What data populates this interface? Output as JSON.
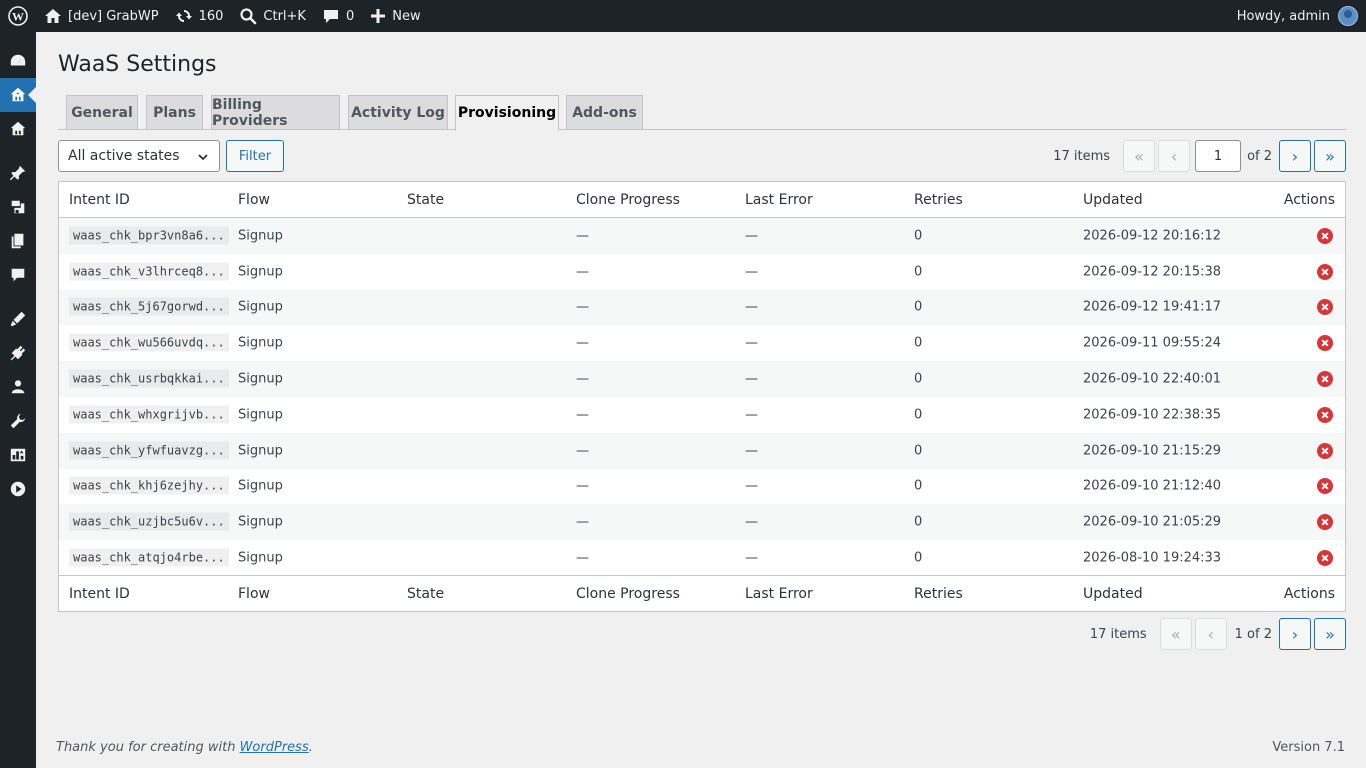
{
  "adminbar": {
    "site_name": "[dev] GrabWP",
    "updates_count": "160",
    "search_shortcut": "Ctrl+K",
    "comments_count": "0",
    "new_label": "New",
    "howdy": "Howdy, admin"
  },
  "page": {
    "title": "WaaS Settings"
  },
  "tabs": [
    {
      "label": "General",
      "active": false
    },
    {
      "label": "Plans",
      "active": false
    },
    {
      "label": "Billing Providers",
      "active": false
    },
    {
      "label": "Activity Log",
      "active": false
    },
    {
      "label": "Provisioning",
      "active": true
    },
    {
      "label": "Add-ons",
      "active": false
    }
  ],
  "filter": {
    "state_select": "All active states",
    "button_label": "Filter"
  },
  "pagination_top": {
    "items": "17 items",
    "first": "«",
    "prev": "‹",
    "current_page": "1",
    "of_label": "of 2",
    "next": "›",
    "last": "»"
  },
  "pagination_bottom": {
    "items": "17 items",
    "first": "«",
    "prev": "‹",
    "page_label": "1 of 2",
    "next": "›",
    "last": "»"
  },
  "table": {
    "columns": [
      "Intent ID",
      "Flow",
      "State",
      "Clone Progress",
      "Last Error",
      "Retries",
      "Updated",
      "Actions"
    ],
    "rows": [
      {
        "intent_id": "waas_chk_bpr3vn8a6...",
        "flow": "Signup",
        "state": "",
        "clone_progress": "—",
        "last_error": "—",
        "retries": "0",
        "updated": "2026-09-12 20:16:12"
      },
      {
        "intent_id": "waas_chk_v3lhrceq8...",
        "flow": "Signup",
        "state": "",
        "clone_progress": "—",
        "last_error": "—",
        "retries": "0",
        "updated": "2026-09-12 20:15:38"
      },
      {
        "intent_id": "waas_chk_5j67gorwd...",
        "flow": "Signup",
        "state": "",
        "clone_progress": "—",
        "last_error": "—",
        "retries": "0",
        "updated": "2026-09-12 19:41:17"
      },
      {
        "intent_id": "waas_chk_wu566uvdq...",
        "flow": "Signup",
        "state": "",
        "clone_progress": "—",
        "last_error": "—",
        "retries": "0",
        "updated": "2026-09-11 09:55:24"
      },
      {
        "intent_id": "waas_chk_usrbqkkai...",
        "flow": "Signup",
        "state": "",
        "clone_progress": "—",
        "last_error": "—",
        "retries": "0",
        "updated": "2026-09-10 22:40:01"
      },
      {
        "intent_id": "waas_chk_whxgrijvb...",
        "flow": "Signup",
        "state": "",
        "clone_progress": "—",
        "last_error": "—",
        "retries": "0",
        "updated": "2026-09-10 22:38:35"
      },
      {
        "intent_id": "waas_chk_yfwfuavzg...",
        "flow": "Signup",
        "state": "",
        "clone_progress": "—",
        "last_error": "—",
        "retries": "0",
        "updated": "2026-09-10 21:15:29"
      },
      {
        "intent_id": "waas_chk_khj6zejhy...",
        "flow": "Signup",
        "state": "",
        "clone_progress": "—",
        "last_error": "—",
        "retries": "0",
        "updated": "2026-09-10 21:12:40"
      },
      {
        "intent_id": "waas_chk_uzjbc5u6v...",
        "flow": "Signup",
        "state": "",
        "clone_progress": "—",
        "last_error": "—",
        "retries": "0",
        "updated": "2026-09-10 21:05:29"
      },
      {
        "intent_id": "waas_chk_atqjo4rbe...",
        "flow": "Signup",
        "state": "",
        "clone_progress": "—",
        "last_error": "—",
        "retries": "0",
        "updated": "2026-08-10 19:24:33"
      }
    ]
  },
  "footer": {
    "thanks_prefix": "Thank you for creating with ",
    "thanks_link": "WordPress",
    "thanks_suffix": ".",
    "version": "Version 7.1"
  },
  "sidebar_icons": [
    "dashboard-icon",
    "waas-icon",
    "network-icon",
    "pin-icon",
    "media-icon",
    "pages-icon",
    "comments-icon",
    "appearance-icon",
    "plugins-icon",
    "users-icon",
    "tools-icon",
    "settings-icon",
    "play-icon"
  ],
  "colors": {
    "accent": "#2271b1",
    "danger": "#d63638",
    "adminbar": "#1d2327"
  }
}
